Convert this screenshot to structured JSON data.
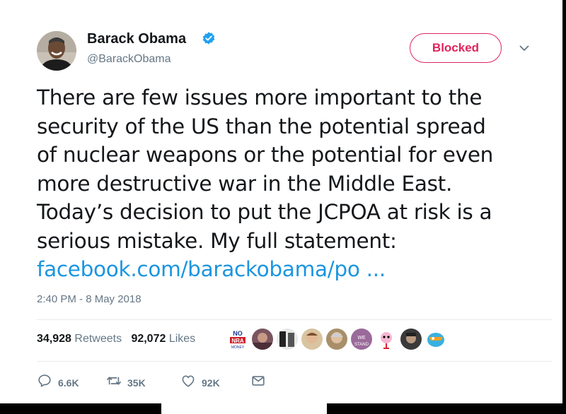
{
  "author": {
    "name": "Barack Obama",
    "handle": "@BarackObama",
    "verified": true
  },
  "follow_button": {
    "label": "Blocked",
    "color": "#e0245e"
  },
  "tweet": {
    "lines": [
      "There are few issues more important to the",
      "security of the US than the potential spread",
      "of nuclear weapons or the potential for even",
      "more destructive war in the Middle East.",
      "Today’s decision to put the JCPOA at risk is a",
      "serious mistake. My full statement:"
    ],
    "link": "facebook.com/barackobama/po ...",
    "link_color": "#1b95e0",
    "timestamp": "2:40 PM - 8 May 2018"
  },
  "stats": {
    "retweets_count": "34,928",
    "retweets_label": "Retweets",
    "likes_count": "92,072",
    "likes_label": "Likes",
    "badge_text": [
      "NO",
      "NRA",
      "MONEY"
    ],
    "avatar_badge_text": [
      "WE",
      "STAND"
    ]
  },
  "actions": {
    "reply": "6.6K",
    "retweet": "35K",
    "like": "92K"
  }
}
